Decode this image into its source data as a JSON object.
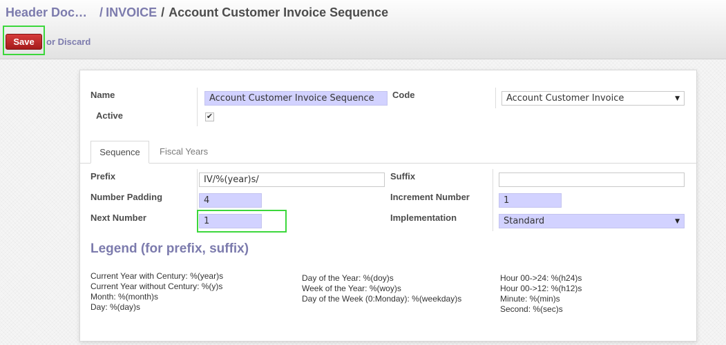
{
  "breadcrumb": {
    "parent": "Header Doc…",
    "middle": "INVOICE",
    "current": "Account Customer Invoice Sequence"
  },
  "toolbar": {
    "save_label": "Save",
    "discard_label": "or Discard"
  },
  "form": {
    "name_label": "Name",
    "name_value": "Account Customer Invoice Sequence",
    "code_label": "Code",
    "code_value": "Account Customer Invoice",
    "active_label": "Active",
    "active_checked": true,
    "check_glyph": "✔"
  },
  "tabs": [
    {
      "label": "Sequence",
      "active": true
    },
    {
      "label": "Fiscal Years",
      "active": false
    }
  ],
  "sequence": {
    "prefix_label": "Prefix",
    "prefix_value": "IV/%(year)s/",
    "suffix_label": "Suffix",
    "suffix_value": "",
    "padding_label": "Number Padding",
    "padding_value": "4",
    "increment_label": "Increment Number",
    "increment_value": "1",
    "next_label": "Next Number",
    "next_value": "1",
    "implementation_label": "Implementation",
    "implementation_value": "Standard"
  },
  "legend": {
    "title": "Legend (for prefix, suffix)",
    "col1": [
      "Current Year with Century: %(year)s",
      "Current Year without Century: %(y)s",
      "Month: %(month)s",
      "Day: %(day)s"
    ],
    "col2": [
      "Day of the Year: %(doy)s",
      "Week of the Year: %(woy)s",
      "Day of the Week (0:Monday): %(weekday)s"
    ],
    "col3": [
      "Hour 00->24: %(h24)s",
      "Hour 00->12: %(h12)s",
      "Minute: %(min)s",
      "Second: %(sec)s"
    ]
  },
  "colors": {
    "accent": "#7c7bad",
    "save_button": "#b22222",
    "required_field": "#d2d2ff",
    "highlight": "#3bd73b"
  },
  "icons": {
    "dropdown": "caret-down-icon",
    "checkbox": "checkmark-icon"
  }
}
